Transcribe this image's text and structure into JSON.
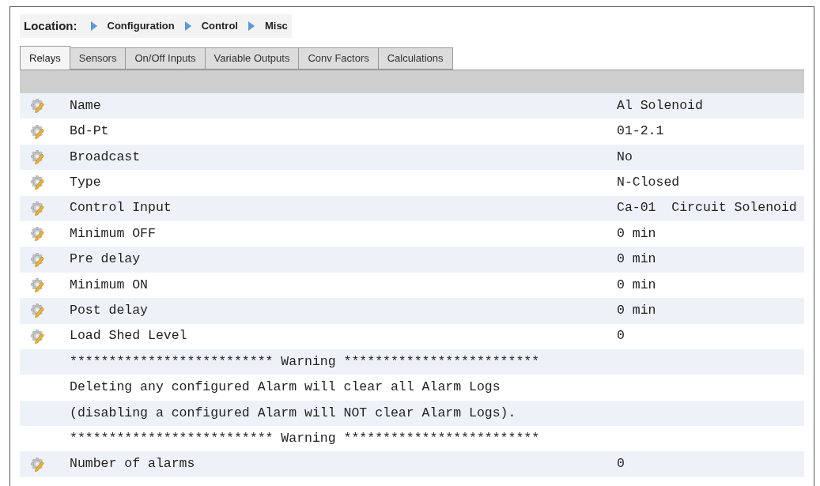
{
  "breadcrumb": {
    "label": "Location:",
    "items": [
      "Configuration",
      "Control",
      "Misc"
    ]
  },
  "tabs": [
    {
      "label": "Relays",
      "selected": true
    },
    {
      "label": "Sensors",
      "selected": false
    },
    {
      "label": "On/Off Inputs",
      "selected": false
    },
    {
      "label": "Variable Outputs",
      "selected": false
    },
    {
      "label": "Conv Factors",
      "selected": false
    },
    {
      "label": "Calculations",
      "selected": false
    }
  ],
  "rows": [
    {
      "kind": "setting",
      "label": "Name",
      "value": "Al Solenoid"
    },
    {
      "kind": "setting",
      "label": "Bd-Pt",
      "value": "01-2.1"
    },
    {
      "kind": "setting",
      "label": "Broadcast",
      "value": "No"
    },
    {
      "kind": "setting",
      "label": "Type",
      "value": "N-Closed"
    },
    {
      "kind": "setting",
      "label": "Control Input",
      "value": "Ca-01  Circuit Solenoid"
    },
    {
      "kind": "setting",
      "label": "Minimum OFF",
      "value": "0 min"
    },
    {
      "kind": "setting",
      "label": "Pre delay",
      "value": "0 min"
    },
    {
      "kind": "setting",
      "label": "Minimum ON",
      "value": "0 min"
    },
    {
      "kind": "setting",
      "label": "Post delay",
      "value": "0 min"
    },
    {
      "kind": "setting",
      "label": "Load Shed Level",
      "value": "0"
    },
    {
      "kind": "note",
      "label": "************************** Warning *************************"
    },
    {
      "kind": "note",
      "label": "Deleting any configured Alarm will clear all Alarm Logs"
    },
    {
      "kind": "note",
      "label": "(disabling a configured Alarm will NOT clear Alarm Logs)."
    },
    {
      "kind": "note",
      "label": "************************** Warning *************************"
    },
    {
      "kind": "setting",
      "label": "Number of alarms",
      "value": "0"
    }
  ]
}
